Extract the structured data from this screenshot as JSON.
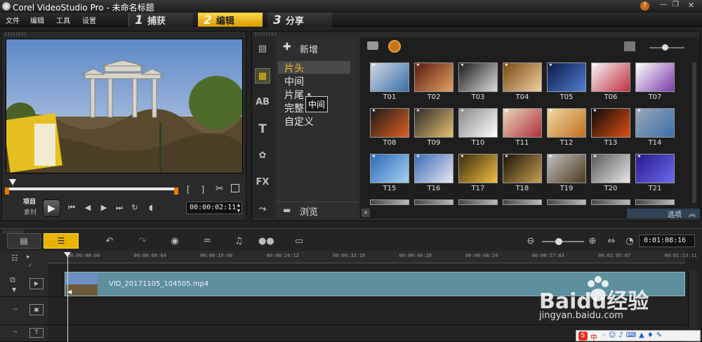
{
  "window": {
    "title": "Corel VideoStudio Pro - 未命名标题",
    "controls": {
      "help": "?",
      "minimize": "—",
      "restore": "❐",
      "close": "✕"
    }
  },
  "menu": [
    "文件",
    "编辑",
    "工具",
    "设置"
  ],
  "steps": [
    {
      "num": "1",
      "label": "捕获"
    },
    {
      "num": "2",
      "label": "编辑"
    },
    {
      "num": "3",
      "label": "分享"
    }
  ],
  "preview": {
    "mode_project": "项目",
    "mode_clip": "素材",
    "timecode": "00:00:02:11",
    "brackets": "[ ]"
  },
  "library": {
    "add_label": "新增",
    "categories": [
      "片头",
      "中间",
      "片尾",
      "完整",
      "自定义"
    ],
    "tooltip": "中间",
    "browse_label": "浏览",
    "options_label": "选项",
    "thumbs": [
      "T01",
      "T02",
      "T03",
      "T04",
      "T05",
      "T06",
      "T07",
      "T08",
      "T09",
      "T10",
      "T11",
      "T12",
      "T13",
      "T14",
      "T15",
      "T16",
      "T17",
      "T18",
      "T19",
      "T20",
      "T21"
    ],
    "side_icons": [
      "media-icon",
      "instant-project-icon",
      "transition-icon",
      "title-icon",
      "graphic-icon",
      "filter-icon",
      "path-icon"
    ]
  },
  "timeline": {
    "duration": "0:01:08:16",
    "ruler": [
      "00:00:00:00",
      "00:00:08:04",
      "00:00:16:08",
      "00:00:24:12",
      "00:00:32:16",
      "00:00:40:20",
      "00:00:48:24",
      "00:00:57:03",
      "00:01:05:07",
      "00:01:13:11"
    ],
    "clip_name": "VID_20171105_104505.mp4",
    "track_label": "T"
  },
  "watermark": {
    "logo_text": "Baidu经验",
    "url": "jingyan.baidu.com",
    "ime_text": "中"
  },
  "colors": {
    "accent": "#f0c020",
    "clip": "#5e8f9e",
    "panel": "#2a2a2a"
  }
}
